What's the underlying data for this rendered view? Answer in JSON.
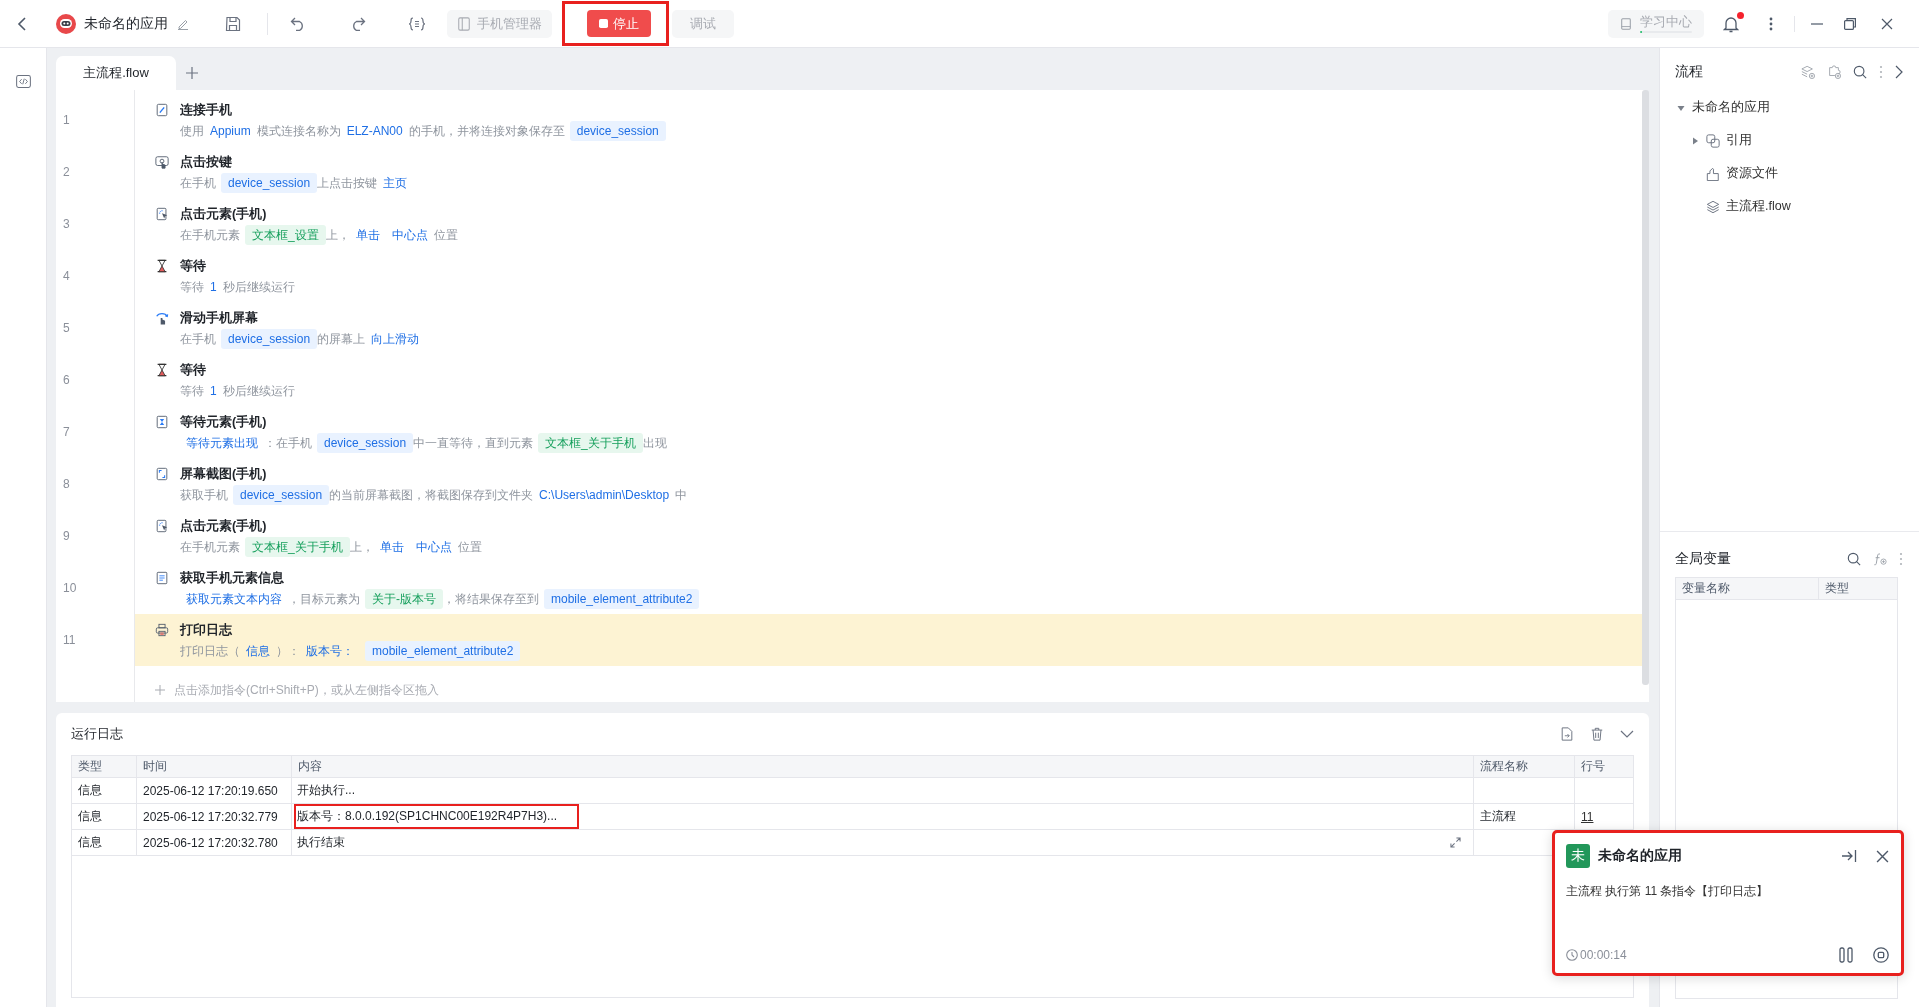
{
  "titlebar": {
    "app_name": "未命名的应用",
    "device_manager": {
      "label": "手机管理器",
      "disabled": true
    },
    "stop": {
      "label": "停止",
      "highlighted": true
    },
    "debug": {
      "label": "调试",
      "disabled": true
    },
    "learning_center": {
      "label": "学习中心",
      "level": 0.04
    },
    "unread": true
  },
  "editor": {
    "tabs": [
      {
        "label": "主流程.flow",
        "selected": true
      }
    ],
    "steps": [
      {
        "number": "1",
        "kind": "connect",
        "title": "连接手机",
        "selected": false,
        "parts": [
          {
            "kind": "text",
            "text": "使用"
          },
          {
            "kind": "value",
            "text": "Appium"
          },
          {
            "kind": "text",
            "text": "模式连接名称为"
          },
          {
            "kind": "value",
            "text": "ELZ-AN00"
          },
          {
            "kind": "text",
            "text": "的手机，并将连接对象保存至"
          },
          {
            "kind": "variable",
            "text": "device_session"
          }
        ]
      },
      {
        "number": "2",
        "kind": "press-key",
        "title": "点击按键",
        "selected": false,
        "parts": [
          {
            "kind": "text",
            "text": "在手机"
          },
          {
            "kind": "variable",
            "text": "device_session"
          },
          {
            "kind": "text",
            "text": "上点击按键"
          },
          {
            "kind": "value",
            "text": "主页"
          }
        ]
      },
      {
        "number": "3",
        "kind": "click-element",
        "title": "点击元素(手机)",
        "selected": false,
        "parts": [
          {
            "kind": "text",
            "text": "在手机元素"
          },
          {
            "kind": "element",
            "text": "文本框_设置"
          },
          {
            "kind": "text",
            "text": "上，"
          },
          {
            "kind": "value",
            "text": "单击"
          },
          {
            "kind": "value",
            "text": "中心点"
          },
          {
            "kind": "text",
            "text": "位置"
          }
        ]
      },
      {
        "number": "4",
        "kind": "wait",
        "title": "等待",
        "selected": false,
        "parts": [
          {
            "kind": "text",
            "text": "等待"
          },
          {
            "kind": "value",
            "text": "1"
          },
          {
            "kind": "text",
            "text": "秒后继续运行"
          }
        ]
      },
      {
        "number": "5",
        "kind": "swipe",
        "title": "滑动手机屏幕",
        "selected": false,
        "parts": [
          {
            "kind": "text",
            "text": "在手机"
          },
          {
            "kind": "variable",
            "text": "device_session"
          },
          {
            "kind": "text",
            "text": "的屏幕上"
          },
          {
            "kind": "value",
            "text": "向上滑动"
          }
        ]
      },
      {
        "number": "6",
        "kind": "wait",
        "title": "等待",
        "selected": false,
        "parts": [
          {
            "kind": "text",
            "text": "等待"
          },
          {
            "kind": "value",
            "text": "1"
          },
          {
            "kind": "text",
            "text": "秒后继续运行"
          }
        ]
      },
      {
        "number": "7",
        "kind": "wait-element",
        "title": "等待元素(手机)",
        "selected": false,
        "parts": [
          {
            "kind": "value",
            "text": "等待元素出现"
          },
          {
            "kind": "text",
            "text": "：在手机"
          },
          {
            "kind": "variable",
            "text": "device_session"
          },
          {
            "kind": "text",
            "text": "中一直等待，直到元素"
          },
          {
            "kind": "element",
            "text": "文本框_关于手机"
          },
          {
            "kind": "text",
            "text": "出现"
          }
        ]
      },
      {
        "number": "8",
        "kind": "screenshot",
        "title": "屏幕截图(手机)",
        "selected": false,
        "parts": [
          {
            "kind": "text",
            "text": "获取手机"
          },
          {
            "kind": "variable",
            "text": "device_session"
          },
          {
            "kind": "text",
            "text": "的当前屏幕截图，将截图保存到文件夹"
          },
          {
            "kind": "value",
            "text": "C:\\Users\\admin\\Desktop"
          },
          {
            "kind": "text",
            "text": "中"
          }
        ]
      },
      {
        "number": "9",
        "kind": "click-element",
        "title": "点击元素(手机)",
        "selected": false,
        "parts": [
          {
            "kind": "text",
            "text": "在手机元素"
          },
          {
            "kind": "element",
            "text": "文本框_关于手机"
          },
          {
            "kind": "text",
            "text": "上，"
          },
          {
            "kind": "value",
            "text": "单击"
          },
          {
            "kind": "value",
            "text": "中心点"
          },
          {
            "kind": "text",
            "text": "位置"
          }
        ]
      },
      {
        "number": "10",
        "kind": "get-info",
        "title": "获取手机元素信息",
        "selected": false,
        "parts": [
          {
            "kind": "value",
            "text": "获取元素文本内容"
          },
          {
            "kind": "text",
            "text": "，目标元素为"
          },
          {
            "kind": "element",
            "text": "关于-版本号"
          },
          {
            "kind": "text",
            "text": "，将结果保存至到"
          },
          {
            "kind": "variable",
            "text": "mobile_element_attribute2"
          }
        ]
      },
      {
        "number": "11",
        "kind": "log",
        "title": "打印日志",
        "selected": true,
        "parts": [
          {
            "kind": "text",
            "text": "打印日志（"
          },
          {
            "kind": "value",
            "text": "信息"
          },
          {
            "kind": "text",
            "text": "）："
          },
          {
            "kind": "value",
            "text": "版本号："
          },
          {
            "kind": "variable",
            "text": "mobile_element_attribute2"
          }
        ]
      }
    ],
    "add_hint": "点击添加指令(Ctrl+Shift+P)，或从左侧指令区拖入"
  },
  "log": {
    "title": "运行日志",
    "columns": [
      "类型",
      "时间",
      "内容",
      "流程名称",
      "行号"
    ],
    "rows": [
      {
        "type": "信息",
        "time": "2025-06-12 17:20:19.650",
        "content": "开始执行...",
        "hovered": false,
        "highlighted": false
      },
      {
        "type": "信息",
        "time": "2025-06-12 17:20:32.779",
        "content": "版本号：8.0.0.192(SP1CHNC00E192R4P7H3)...",
        "flow": "主流程",
        "line": "11",
        "hovered": false,
        "highlighted": true
      },
      {
        "type": "信息",
        "time": "2025-06-12 17:20:32.780",
        "content": "执行结束",
        "hovered": true,
        "highlighted": false
      }
    ]
  },
  "flow_panel": {
    "title": "流程",
    "tree": [
      {
        "label": "未命名的应用",
        "expanded": true,
        "children": [
          {
            "label": "引用",
            "kind": "reference",
            "expanded": false
          },
          {
            "label": "资源文件",
            "kind": "resource"
          },
          {
            "label": "主流程.flow",
            "kind": "flow"
          }
        ]
      }
    ]
  },
  "variables_panel": {
    "title": "全局变量",
    "columns": [
      "变量名称",
      "类型"
    ]
  },
  "notification": {
    "avatar": "未",
    "title": "未命名的应用",
    "message": "主流程 执行第 11 条指令【打印日志】",
    "elapsed": "00:00:14",
    "highlighted": true
  }
}
